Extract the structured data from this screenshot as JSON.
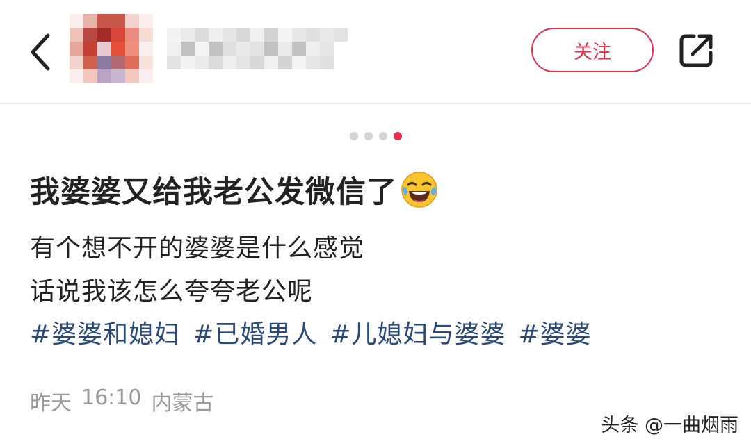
{
  "header": {
    "follow_label": "关注",
    "back_icon": "chevron-left-icon",
    "share_icon": "share-icon",
    "accent_color": "#e4304b"
  },
  "carousel": {
    "total": 4,
    "active_index": 3
  },
  "post": {
    "title": "我婆婆又给我老公发微信了",
    "title_emoji": "laughing-with-tears-emoji",
    "lines": [
      "有个想不开的婆婆是什么感觉",
      "话说我该怎么夸夸老公呢"
    ],
    "tags": [
      "#婆婆和媳妇",
      "#已婚男人",
      "#儿媳妇与婆婆",
      "#婆婆"
    ],
    "tag_color": "#2a4a7a",
    "meta": {
      "date": "昨天",
      "time": "16:10",
      "location": "内蒙古"
    }
  },
  "watermark": "头条 @一曲烟雨"
}
